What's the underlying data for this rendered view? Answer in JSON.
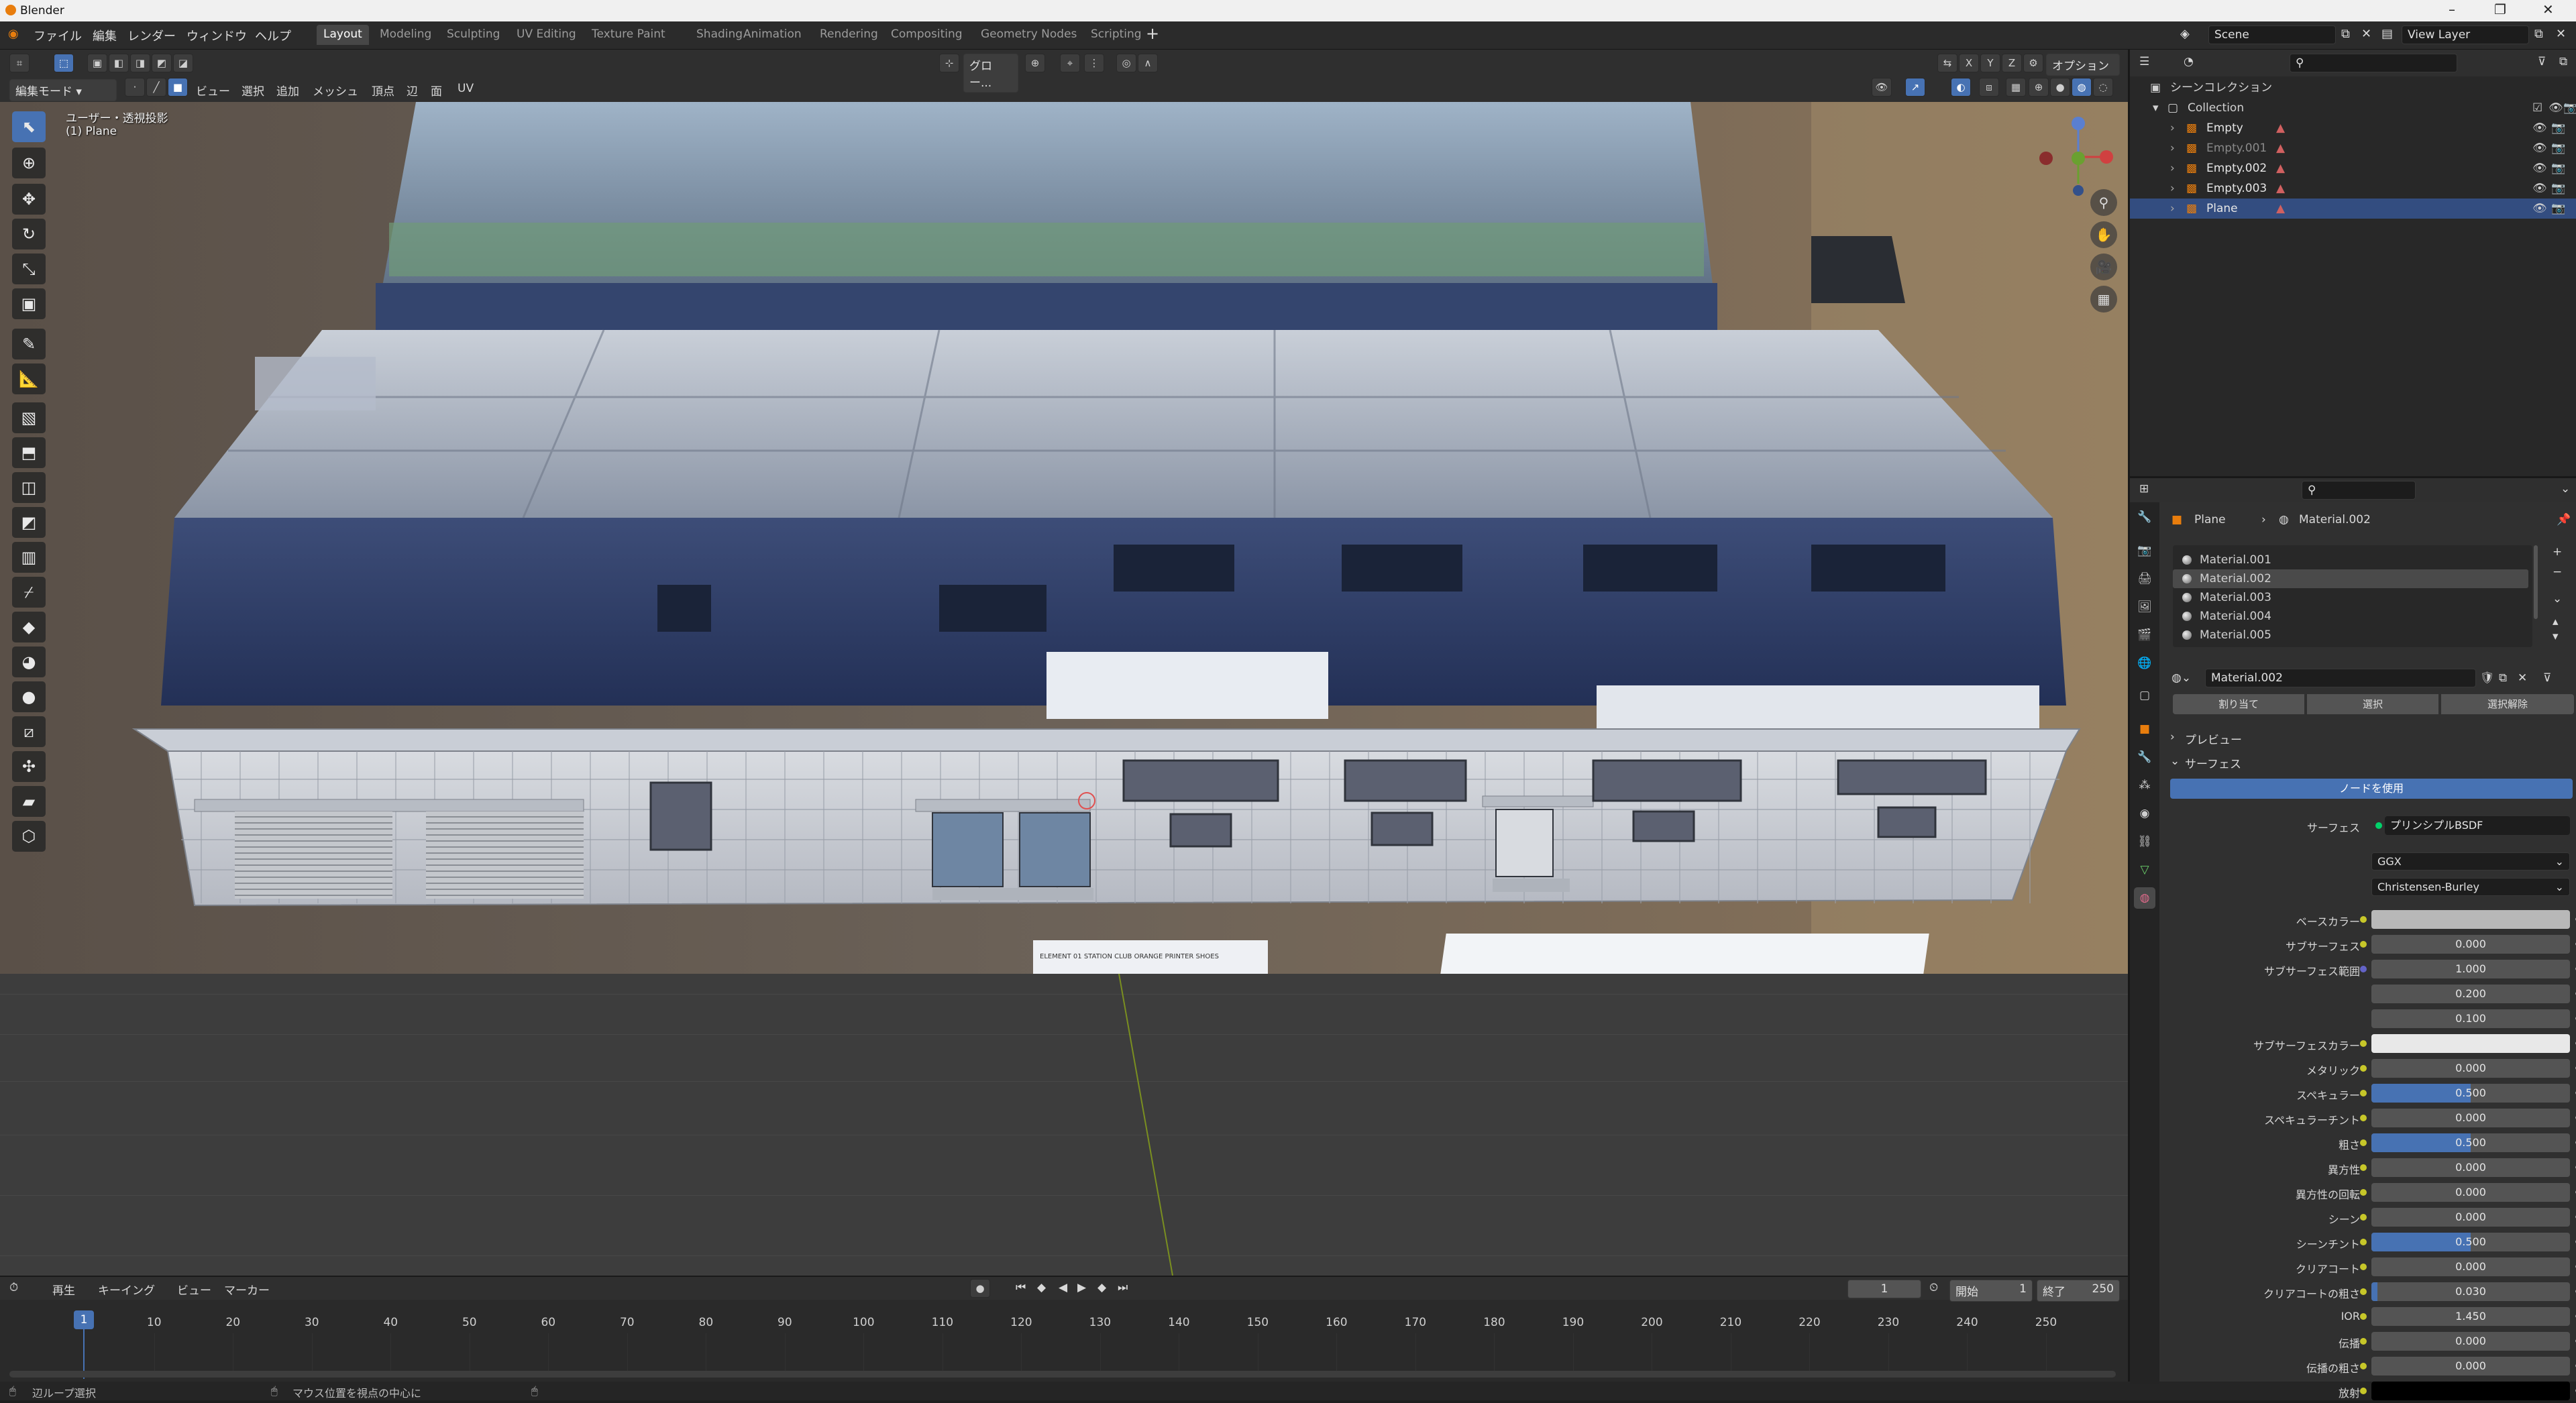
{
  "window": {
    "title": "Blender"
  },
  "menubar": {
    "items": [
      "ファイル",
      "編集",
      "レンダー",
      "ウィンドウ",
      "ヘルプ"
    ]
  },
  "workspaces": [
    "Layout",
    "Modeling",
    "Sculpting",
    "UV Editing",
    "Texture Paint",
    "Shading",
    "Animation",
    "Rendering",
    "Compositing",
    "Geometry Nodes",
    "Scripting"
  ],
  "active_workspace": "Layout",
  "scene": {
    "label": "Scene",
    "view_layer": "View Layer"
  },
  "viewport_header": {
    "mode": "編集モード",
    "menus": [
      "ビュー",
      "選択",
      "追加",
      "メッシュ",
      "頂点",
      "辺",
      "面",
      "UV"
    ],
    "transform": "グロー...",
    "options": "オプション",
    "axes": [
      "X",
      "Y",
      "Z"
    ]
  },
  "viewport": {
    "view_name": "ユーザー・透視投影",
    "object_name": "(1) Plane",
    "sign_text": "ELEMENT 01 STATION CLUB ORANGE PRINTER SHOES"
  },
  "timeline": {
    "menus": [
      "再生",
      "キーイング",
      "ビュー",
      "マーカー"
    ],
    "current_frame": "1",
    "start_label": "開始",
    "start": "1",
    "end_label": "終了",
    "end": "250",
    "ticks": [
      "1",
      "10",
      "20",
      "30",
      "40",
      "50",
      "60",
      "70",
      "80",
      "90",
      "100",
      "110",
      "120",
      "130",
      "140",
      "150",
      "160",
      "170",
      "180",
      "190",
      "200",
      "210",
      "220",
      "230",
      "240",
      "250"
    ]
  },
  "status": {
    "left": "辺ループ選択",
    "middle": "マウス位置を視点の中心に"
  },
  "outliner": {
    "root": "シーンコレクション",
    "collection": "Collection",
    "items": [
      {
        "name": "Empty",
        "dim": false
      },
      {
        "name": "Empty.001",
        "dim": true
      },
      {
        "name": "Empty.002",
        "dim": false
      },
      {
        "name": "Empty.003",
        "dim": false
      },
      {
        "name": "Plane",
        "dim": false,
        "selected": true
      }
    ]
  },
  "properties": {
    "breadcrumb_object": "Plane",
    "breadcrumb_material": "Material.002",
    "slots": [
      "Material.001",
      "Material.002",
      "Material.003",
      "Material.004",
      "Material.005"
    ],
    "selected_slot": "Material.002",
    "material_name": "Material.002",
    "slot_buttons": [
      "割り当て",
      "選択",
      "選択解除"
    ],
    "panels": {
      "preview": "プレビュー",
      "surface": "サーフェス"
    },
    "use_nodes": "ノードを使用",
    "surface_label": "サーフェス",
    "surface_value": "プリンシプルBSDF",
    "distribution": "GGX",
    "subsurface_method": "Christensen-Burley",
    "rows": [
      {
        "label": "ベースカラー",
        "value": "",
        "dot": "yellow",
        "fill": 0,
        "swatch": "#b8b8b8"
      },
      {
        "label": "サブサーフェス",
        "value": "0.000",
        "dot": "yellow",
        "fill": 0
      },
      {
        "label": "サブサーフェス範囲",
        "value": "1.000",
        "dot": "blue",
        "fill": 0
      },
      {
        "label": "",
        "value": "0.200",
        "dot": "",
        "fill": 0
      },
      {
        "label": "",
        "value": "0.100",
        "dot": "",
        "fill": 0
      },
      {
        "label": "サブサーフェスカラー",
        "value": "",
        "dot": "yellow",
        "fill": 0,
        "swatch": "#e8e8e8"
      },
      {
        "label": "メタリック",
        "value": "0.000",
        "dot": "yellow",
        "fill": 0
      },
      {
        "label": "スペキュラー",
        "value": "0.500",
        "dot": "yellow",
        "fill": 0.5
      },
      {
        "label": "スペキュラーチント",
        "value": "0.000",
        "dot": "yellow",
        "fill": 0
      },
      {
        "label": "粗さ",
        "value": "0.500",
        "dot": "yellow",
        "fill": 0.5
      },
      {
        "label": "異方性",
        "value": "0.000",
        "dot": "yellow",
        "fill": 0
      },
      {
        "label": "異方性の回転",
        "value": "0.000",
        "dot": "yellow",
        "fill": 0
      },
      {
        "label": "シーン",
        "value": "0.000",
        "dot": "yellow",
        "fill": 0
      },
      {
        "label": "シーンチント",
        "value": "0.500",
        "dot": "yellow",
        "fill": 0.5
      },
      {
        "label": "クリアコート",
        "value": "0.000",
        "dot": "yellow",
        "fill": 0
      },
      {
        "label": "クリアコートの粗さ",
        "value": "0.030",
        "dot": "yellow",
        "fill": 0.03
      },
      {
        "label": "IOR",
        "value": "1.450",
        "dot": "yellow",
        "fill": 0
      },
      {
        "label": "伝播",
        "value": "0.000",
        "dot": "yellow",
        "fill": 0
      },
      {
        "label": "伝播の粗さ",
        "value": "0.000",
        "dot": "yellow",
        "fill": 0
      },
      {
        "label": "放射",
        "value": "",
        "dot": "yellow",
        "fill": 0,
        "swatch": "#000000"
      }
    ]
  },
  "colors": {
    "accent": "#4772b3",
    "selection": "#334d80",
    "orange": "#e87d0d"
  }
}
